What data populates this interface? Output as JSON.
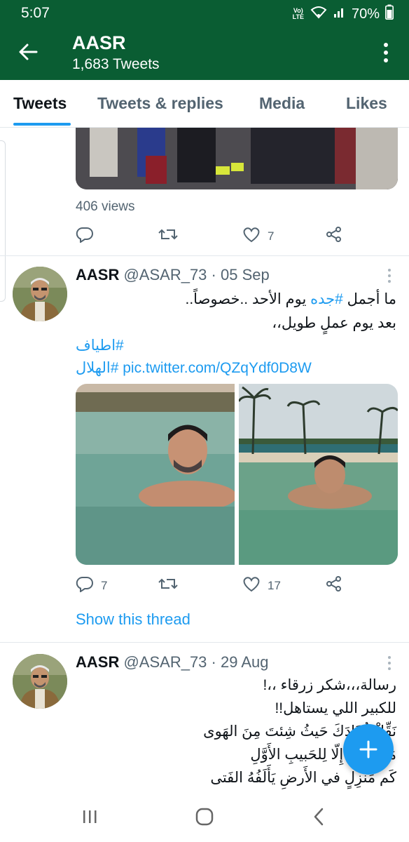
{
  "status_bar": {
    "time": "5:07",
    "network_label": "Vo) LTE",
    "battery": "70%"
  },
  "app_bar": {
    "title": "AASR",
    "subtitle": "1,683 Tweets"
  },
  "tabs": [
    {
      "label": "Tweets",
      "active": true
    },
    {
      "label": "Tweets & replies",
      "active": false
    },
    {
      "label": "Media",
      "active": false
    },
    {
      "label": "Likes",
      "active": false
    }
  ],
  "tweets": [
    {
      "views": "406 views",
      "replies": "",
      "retweets": "",
      "likes": "7"
    },
    {
      "name": "AASR",
      "handle": "@ASAR_73",
      "date": "· 05 Sep",
      "text_line1_prefix": "ما أجمل ",
      "text_line1_hashtag": "#جده",
      "text_line1_suffix": " يوم الأحد ..خصوصاً..",
      "text_line2": "بعد يوم عملٍ طويل،،",
      "hashtag_line": "#اطياف",
      "hashtag_line2": "#الهلال",
      "pic_link": "pic.twitter.com/QZqYdf0D8W",
      "replies": "7",
      "retweets": "",
      "likes": "17",
      "show_thread": "Show this thread"
    },
    {
      "name": "AASR",
      "handle": "@ASAR_73",
      "date": "· 29 Aug",
      "lines": [
        "رسالة،،،شكر زرقاء ،،!",
        "للكبير اللي يستاهل!!",
        "نَقِّلْ فُؤَادَكَ حَيثُ شِئتَ مِنَ الهَوى",
        "مَا الحُبُّ إِلّا لِلحَبيبِ الأَوَّلِ",
        "كَم مَنزِلٍ في الأَرضِ يَأَلَفُهُ الفَتى"
      ]
    }
  ],
  "colors": {
    "header_green": "#0a5d33",
    "accent_blue": "#1d9bf0",
    "muted_gray": "#536471"
  }
}
